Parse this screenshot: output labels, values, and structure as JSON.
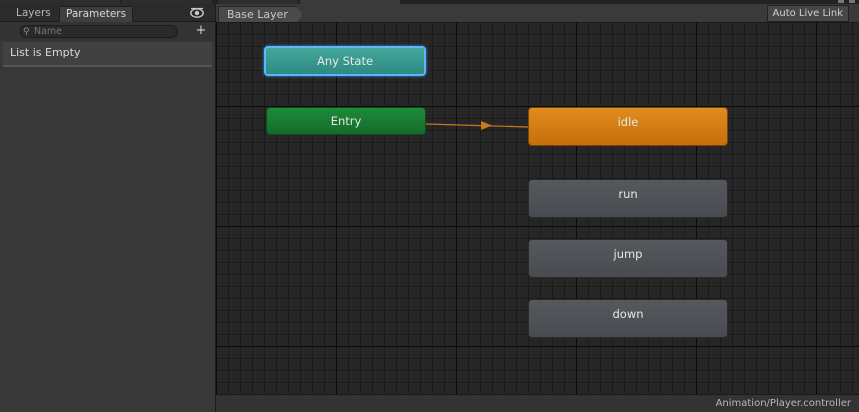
{
  "left_panel": {
    "tabs": [
      {
        "label": "Layers"
      },
      {
        "label": "Parameters"
      }
    ],
    "search": {
      "placeholder": "Name",
      "value": ""
    },
    "add_label": "+",
    "empty_message": "List is Empty"
  },
  "toolbar": {
    "breadcrumb": "Base Layer",
    "auto_live_link": "Auto Live Link"
  },
  "graph": {
    "nodes": {
      "any_state": "Any State",
      "entry": "Entry",
      "idle": "idle",
      "run": "run",
      "jump": "jump",
      "down": "down"
    },
    "colors": {
      "any_state": "#3a9a90",
      "entry": "#1a7d34",
      "default_state": "#d47d14",
      "state": "#4f5357",
      "transition": "#c77a1e",
      "selection": "#57b8ff"
    }
  },
  "status_bar": {
    "path": "Animation/Player.controller"
  },
  "icons": {
    "eye": "eye-icon",
    "search": "search-icon",
    "add": "add-icon"
  }
}
